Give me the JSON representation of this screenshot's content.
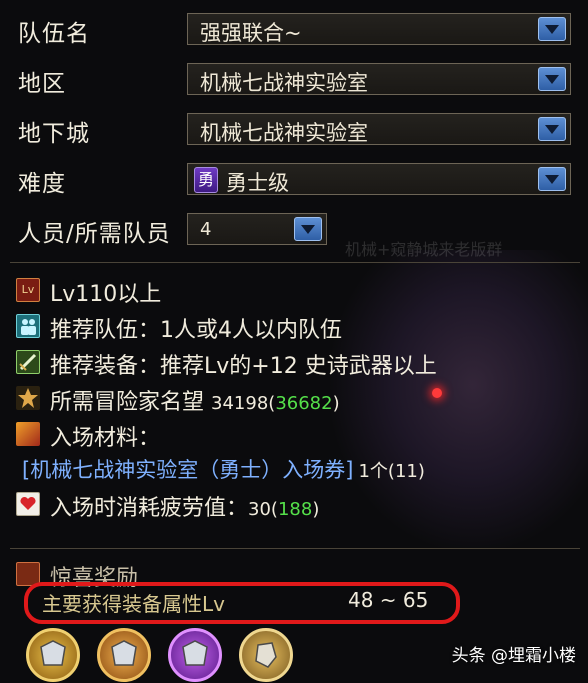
{
  "form": {
    "team_name": {
      "label": "队伍名",
      "value": "强强联合~"
    },
    "region": {
      "label": "地区",
      "value": "机械七战神实验室"
    },
    "dungeon": {
      "label": "地下城",
      "value": "机械七战神实验室"
    },
    "difficulty": {
      "label": "难度",
      "badge": "勇",
      "value": "勇士级"
    },
    "members": {
      "label": "人员/所需队员",
      "value": "4"
    }
  },
  "background_text": "机械+窥静城来老版群",
  "info": {
    "level": "Lv110以上",
    "team": "推荐队伍：1人或4人以内队伍",
    "equip": "推荐装备：推荐Lv的+12 史诗武器以上",
    "fame_label": "所需冒险家名望",
    "fame_value": "34198",
    "fame_current": "36682",
    "material_label": "入场材料：",
    "ticket": "[机械七战神实验室（勇士）入场券]",
    "ticket_count": "1个(11)",
    "fatigue_label": "入场时消耗疲劳值：",
    "fatigue_value": "30",
    "fatigue_current": "188"
  },
  "reward": {
    "title": "惊喜奖励",
    "attr_label": "主要获得装备属性Lv",
    "attr_range": "48 ~ 65"
  },
  "watermark": "头条 @埋霜小楼",
  "colors": {
    "accent_blue": "#3d6fbd",
    "green": "#55e04a",
    "highlight_red": "#e0191a",
    "purple": "#6f3bc4"
  }
}
